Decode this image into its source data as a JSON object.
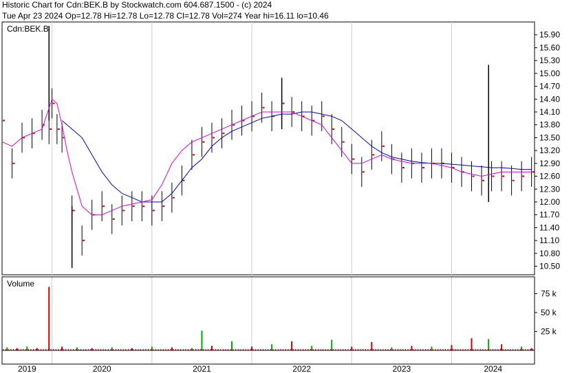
{
  "header": {
    "line1": "Historic Chart for Cdn:BEK.B by Stockwatch.com 604.687.1500 - (c) 2024",
    "line2": "Tue Apr 23 2024   Op=12.78   Hi=12.78   Lo=12.78   Cl=12.78   Vol=274   Year hi=16.11   lo=10.46"
  },
  "colors": {
    "bars": "#000000",
    "close_marker": "#cc0000",
    "ma_short": "#dd00dd",
    "ma_long": "#0000cc",
    "volume_up": "#00aa00",
    "volume_down": "#cc0000"
  },
  "chart_data": [
    {
      "type": "line",
      "title": "",
      "legend": "Cdn:BEK.B",
      "y_axis_side": "right",
      "ylim": [
        10.3,
        16.2
      ],
      "yticks": [
        15.9,
        15.6,
        15.3,
        15.0,
        14.7,
        14.4,
        14.1,
        13.8,
        13.5,
        13.2,
        12.9,
        12.6,
        12.3,
        12.0,
        11.7,
        11.4,
        11.1,
        10.8,
        10.5
      ],
      "x_labels": [
        "2019",
        "2020",
        "2021",
        "2022",
        "2023",
        "2024"
      ],
      "x_range": [
        2019.0,
        2024.33
      ],
      "year_boundaries": [
        2019.5,
        2020.5,
        2021.5,
        2022.5,
        2023.5
      ],
      "grid": "vertical at year boundaries",
      "price_series": {
        "x": [
          2019.0,
          2019.1,
          2019.2,
          2019.3,
          2019.4,
          2019.47,
          2019.5,
          2019.55,
          2019.6,
          2019.7,
          2019.8,
          2019.9,
          2020.0,
          2020.1,
          2020.2,
          2020.3,
          2020.4,
          2020.5,
          2020.6,
          2020.7,
          2020.8,
          2020.9,
          2021.0,
          2021.1,
          2021.2,
          2021.3,
          2021.4,
          2021.5,
          2021.6,
          2021.7,
          2021.8,
          2021.9,
          2022.0,
          2022.1,
          2022.2,
          2022.3,
          2022.4,
          2022.5,
          2022.6,
          2022.7,
          2022.8,
          2022.9,
          2023.0,
          2023.1,
          2023.2,
          2023.3,
          2023.4,
          2023.5,
          2023.6,
          2023.7,
          2023.8,
          2023.9,
          2024.0,
          2024.1,
          2024.2,
          2024.3
        ],
        "close": [
          13.9,
          12.9,
          13.5,
          13.6,
          13.8,
          13.7,
          14.3,
          13.7,
          13.5,
          11.8,
          11.1,
          11.7,
          11.9,
          11.6,
          11.8,
          11.9,
          11.9,
          11.8,
          11.9,
          12.1,
          12.5,
          13.1,
          13.4,
          13.5,
          13.6,
          13.8,
          13.9,
          14.0,
          14.2,
          14.0,
          14.3,
          14.1,
          14.0,
          13.9,
          14.0,
          13.7,
          13.4,
          13.0,
          12.7,
          13.1,
          13.3,
          13.0,
          12.8,
          12.9,
          12.8,
          12.9,
          12.9,
          12.8,
          12.7,
          12.6,
          12.5,
          12.6,
          12.6,
          12.5,
          12.6,
          12.7
        ]
      },
      "ma_short": {
        "x": [
          2019.0,
          2019.1,
          2019.2,
          2019.3,
          2019.4,
          2019.5,
          2019.55,
          2019.6,
          2019.65,
          2019.7,
          2019.8,
          2019.9,
          2020.0,
          2020.1,
          2020.2,
          2020.3,
          2020.4,
          2020.5,
          2020.6,
          2020.7,
          2020.8,
          2020.9,
          2021.0,
          2021.1,
          2021.2,
          2021.3,
          2021.4,
          2021.5,
          2021.6,
          2021.7,
          2021.8,
          2021.9,
          2022.0,
          2022.1,
          2022.2,
          2022.3,
          2022.4,
          2022.5,
          2022.6,
          2022.7,
          2022.8,
          2022.9,
          2023.0,
          2023.1,
          2023.2,
          2023.3,
          2023.4,
          2023.5,
          2023.6,
          2023.7,
          2023.8,
          2023.9,
          2024.0,
          2024.1,
          2024.2,
          2024.3
        ],
        "y": [
          13.4,
          13.3,
          13.5,
          13.6,
          13.7,
          14.4,
          14.3,
          13.8,
          13.2,
          12.7,
          11.9,
          11.7,
          11.7,
          11.8,
          11.9,
          11.95,
          12.0,
          12.05,
          12.4,
          12.9,
          13.2,
          13.4,
          13.5,
          13.6,
          13.7,
          13.8,
          13.9,
          14.0,
          14.1,
          14.1,
          14.1,
          14.1,
          14.0,
          13.9,
          13.8,
          13.5,
          13.2,
          12.9,
          12.9,
          13.0,
          13.1,
          13.0,
          12.95,
          12.9,
          12.9,
          12.9,
          12.85,
          12.8,
          12.7,
          12.65,
          12.6,
          12.65,
          12.7,
          12.7,
          12.7,
          12.7
        ]
      },
      "ma_long": {
        "x": [
          2019.6,
          2019.7,
          2019.8,
          2019.9,
          2020.0,
          2020.1,
          2020.2,
          2020.3,
          2020.4,
          2020.5,
          2020.6,
          2020.7,
          2020.8,
          2020.9,
          2021.0,
          2021.1,
          2021.2,
          2021.3,
          2021.4,
          2021.5,
          2021.6,
          2021.7,
          2021.8,
          2021.9,
          2022.0,
          2022.1,
          2022.2,
          2022.3,
          2022.4,
          2022.5,
          2022.6,
          2022.7,
          2022.8,
          2022.9,
          2023.0,
          2023.1,
          2023.2,
          2023.3,
          2023.4,
          2023.5,
          2023.6,
          2023.7,
          2023.8,
          2023.9,
          2024.0,
          2024.1,
          2024.2,
          2024.3
        ],
        "y": [
          13.9,
          13.7,
          13.5,
          13.1,
          12.7,
          12.4,
          12.2,
          12.1,
          12.0,
          12.0,
          12.0,
          12.2,
          12.5,
          12.8,
          13.0,
          13.3,
          13.5,
          13.65,
          13.75,
          13.85,
          13.95,
          14.0,
          14.05,
          14.05,
          14.1,
          14.1,
          14.05,
          14.0,
          13.9,
          13.7,
          13.5,
          13.3,
          13.15,
          13.05,
          13.0,
          12.95,
          12.92,
          12.9,
          12.9,
          12.88,
          12.86,
          12.84,
          12.82,
          12.8,
          12.8,
          12.78,
          12.76,
          12.76
        ]
      },
      "spikes": [
        {
          "x": 2019.47,
          "low": 13.9,
          "high": 16.11
        },
        {
          "x": 2019.7,
          "low": 10.46,
          "high": 11.9
        },
        {
          "x": 2021.8,
          "low": 13.7,
          "high": 14.9
        },
        {
          "x": 2023.87,
          "low": 12.0,
          "high": 15.2
        }
      ]
    },
    {
      "type": "bar",
      "title": "Volume",
      "y_axis_side": "right",
      "ylim": [
        0,
        90000
      ],
      "yticks": [
        {
          "value": 75000,
          "label": "75 k"
        },
        {
          "value": 50000,
          "label": "50 k"
        },
        {
          "value": 25000,
          "label": "25 k"
        }
      ],
      "x": [
        2019.05,
        2019.15,
        2019.25,
        2019.35,
        2019.47,
        2019.6,
        2019.75,
        2019.9,
        2020.1,
        2020.3,
        2020.5,
        2020.7,
        2020.9,
        2021.0,
        2021.1,
        2021.3,
        2021.5,
        2021.7,
        2021.9,
        2022.1,
        2022.3,
        2022.5,
        2022.7,
        2022.9,
        2023.1,
        2023.3,
        2023.5,
        2023.7,
        2023.87,
        2024.0,
        2024.2,
        2024.3
      ],
      "values": [
        4000,
        3000,
        5000,
        3000,
        84000,
        5000,
        4000,
        3000,
        4000,
        3000,
        5000,
        4000,
        3000,
        26000,
        6000,
        12000,
        5000,
        8000,
        12000,
        6000,
        14000,
        5000,
        11000,
        4000,
        6000,
        5000,
        7000,
        16000,
        15000,
        8000,
        5000,
        3000
      ],
      "direction": [
        "up",
        "down",
        "up",
        "down",
        "down",
        "down",
        "up",
        "down",
        "up",
        "down",
        "up",
        "down",
        "up",
        "up",
        "down",
        "up",
        "down",
        "up",
        "down",
        "up",
        "up",
        "down",
        "down",
        "up",
        "down",
        "up",
        "down",
        "down",
        "up",
        "down",
        "up",
        "down"
      ]
    }
  ]
}
